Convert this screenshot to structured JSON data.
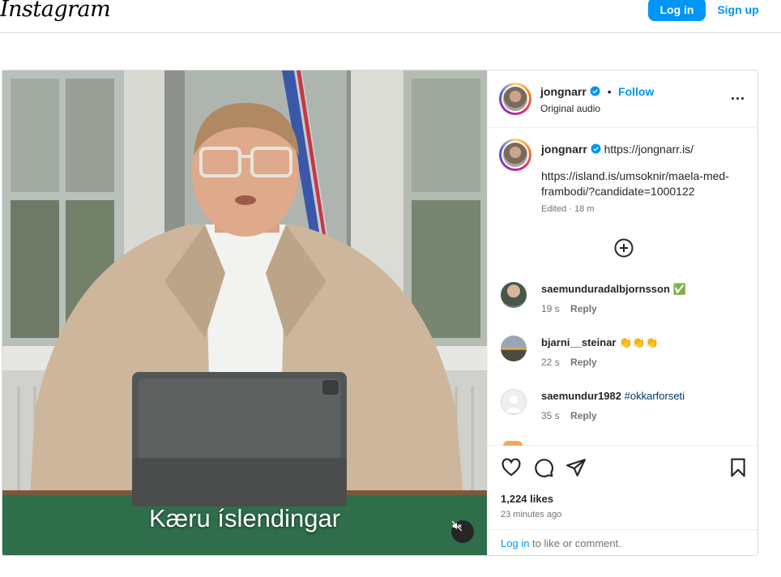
{
  "header": {
    "logo": "Instagram",
    "login_label": "Log in",
    "signup_label": "Sign up"
  },
  "video": {
    "subtitle": "Kæru íslendingar",
    "mute_icon": "speaker-muted-icon"
  },
  "post_header": {
    "username": "jongnarr",
    "separator": "•",
    "follow_label": "Follow",
    "audio_label": "Original audio",
    "more_icon": "more-options-icon"
  },
  "caption": {
    "username": "jongnarr",
    "first_line": "https://jongnarr.is/",
    "link_line1": "https://island.is/umsoknir/maela-med-",
    "link_line2": "frambodi/?candidate=1000122",
    "edited": "Edited · 18 m"
  },
  "comments": [
    {
      "username": "saemunduradalbjornsson",
      "text": "",
      "emoji": "✅",
      "time": "19 s",
      "reply": "Reply"
    },
    {
      "username": "bjarni__steinar",
      "text": "",
      "emoji": "👏👏👏",
      "time": "22 s",
      "reply": "Reply"
    },
    {
      "username": "saemundur1982",
      "text": "#okkarforseti",
      "emoji": "",
      "time": "35 s",
      "reply": "Reply"
    }
  ],
  "actions": {
    "likes": "1,224 likes",
    "time_ago": "23 minutes ago",
    "login_link": "Log in",
    "login_suffix": " to like or comment."
  },
  "colors": {
    "accent": "#0095f6",
    "border": "#dbdbdb",
    "muted_text": "#737373",
    "verified": "#0095f6"
  }
}
